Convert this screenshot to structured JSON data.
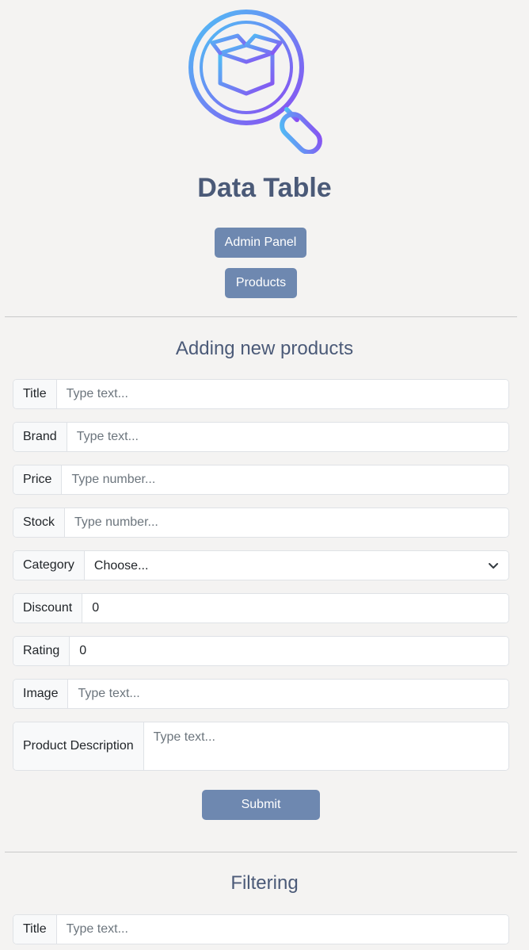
{
  "header": {
    "logo_icon": "box-search-icon",
    "title": "Data Table",
    "nav_buttons": [
      "Admin Panel",
      "Products"
    ]
  },
  "add_form": {
    "title": "Adding new products",
    "fields": [
      {
        "label": "Title",
        "placeholder": "Type text...",
        "value": ""
      },
      {
        "label": "Brand",
        "placeholder": "Type text...",
        "value": ""
      },
      {
        "label": "Price",
        "placeholder": "Type number...",
        "value": ""
      },
      {
        "label": "Stock",
        "placeholder": "Type number...",
        "value": ""
      },
      {
        "label": "Category",
        "selected": "Choose..."
      },
      {
        "label": "Discount",
        "value": "0"
      },
      {
        "label": "Rating",
        "value": "0"
      },
      {
        "label": "Image",
        "placeholder": "Type text...",
        "value": ""
      },
      {
        "label": "Product Description",
        "placeholder": "Type text...",
        "value": ""
      }
    ],
    "submit_label": "Submit"
  },
  "filtering": {
    "title": "Filtering",
    "fields": [
      {
        "label": "Title",
        "placeholder": "Type text...",
        "value": ""
      }
    ]
  },
  "colors": {
    "accent": "#6e88b0",
    "heading": "#4b5a78",
    "background": "#f4f3f2"
  }
}
